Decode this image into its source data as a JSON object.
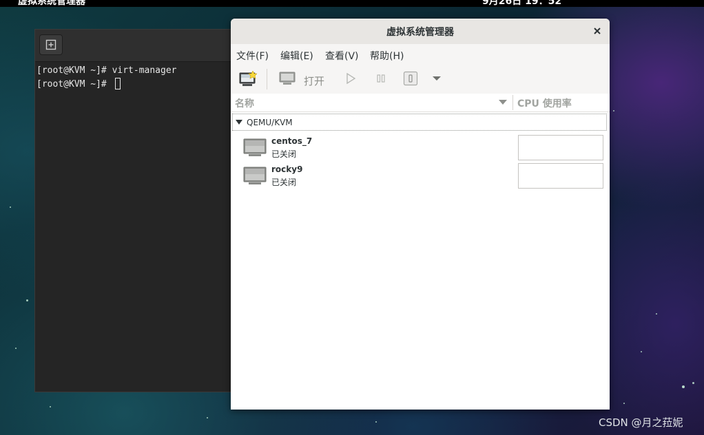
{
  "top_bar": {
    "app_name": "虚拟系统管理器",
    "clock": "9月26日 19：52"
  },
  "terminal": {
    "lines": [
      "[root@KVM ~]# virt-manager",
      "[root@KVM ~]# "
    ]
  },
  "window": {
    "title": "虚拟系统管理器",
    "menu": {
      "file": "文件(F)",
      "edit": "编辑(E)",
      "view": "查看(V)",
      "help": "帮助(H)"
    },
    "toolbar": {
      "open_label": "打开"
    },
    "columns": {
      "name": "名称",
      "cpu": "CPU 使用率"
    },
    "group": {
      "label": "QEMU/KVM"
    },
    "vms": [
      {
        "name": "centos_7",
        "state": "已关闭"
      },
      {
        "name": "rocky9",
        "state": "已关闭"
      }
    ]
  },
  "watermark": "CSDN @月之菈妮",
  "icons": {
    "new_vm": "new-vm-icon",
    "open": "monitor-icon",
    "run": "play-icon",
    "pause": "pause-icon",
    "shutdown": "power-icon",
    "menu_arrow": "chevron-down-icon",
    "close": "close-icon"
  }
}
